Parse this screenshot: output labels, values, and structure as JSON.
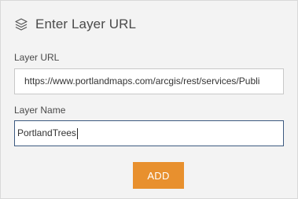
{
  "panel": {
    "title": "Enter Layer URL",
    "title_icon": "layers-icon"
  },
  "layer_url": {
    "label": "Layer URL",
    "value": "https://www.portlandmaps.com/arcgis/rest/services/Publi"
  },
  "layer_name": {
    "label": "Layer Name",
    "value": "PortlandTrees"
  },
  "actions": {
    "add_label": "ADD"
  },
  "colors": {
    "accent": "#e8902e",
    "focus_border": "#3d5a80",
    "panel_bg": "#f3f3f3"
  }
}
